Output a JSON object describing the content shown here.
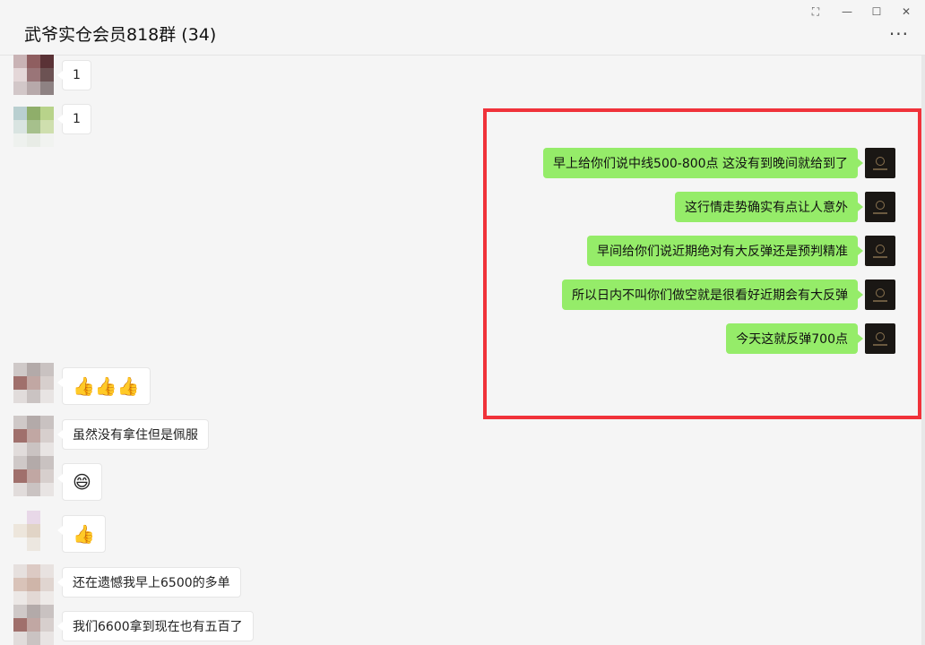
{
  "window": {
    "title": "武爷实仓会员818群 (34)",
    "pin_glyph": "⛶",
    "minimize_glyph": "—",
    "maximize_glyph": "☐",
    "close_glyph": "✕",
    "more_glyph": "···"
  },
  "messages_left": [
    {
      "text": "1"
    },
    {
      "text": "1"
    },
    {
      "text": "👍👍👍"
    },
    {
      "text": "虽然没有拿住但是佩服"
    },
    {
      "text": "😄"
    },
    {
      "text": "👍"
    },
    {
      "text": "还在遗憾我早上6500的多单"
    },
    {
      "text": "我们6600拿到现在也有五百了"
    }
  ],
  "messages_right": [
    {
      "text": "早上给你们说中线500-800点 这没有到晚间就给到了"
    },
    {
      "text": "这行情走势确实有点让人意外"
    },
    {
      "text": "早间给你们说近期绝对有大反弹还是预判精准"
    },
    {
      "text": "所以日内不叫你们做空就是很看好近期会有大反弹"
    },
    {
      "text": "今天这就反弹700点"
    }
  ],
  "colors": {
    "bubble_self": "#95ec69",
    "bubble_other": "#ffffff",
    "highlight_border": "#f0323a",
    "background": "#f5f5f5"
  }
}
